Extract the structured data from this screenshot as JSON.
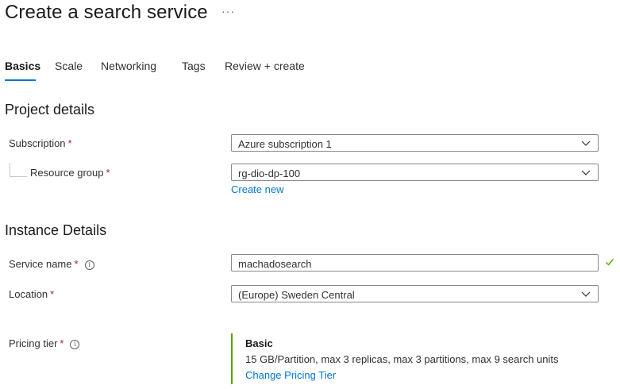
{
  "page": {
    "title": "Create a search service",
    "more_label": "···"
  },
  "tabs": [
    {
      "label": "Basics",
      "active": true
    },
    {
      "label": "Scale"
    },
    {
      "label": "Networking"
    },
    {
      "label": "Tags"
    },
    {
      "label": "Review + create"
    }
  ],
  "project_details": {
    "heading": "Project details",
    "subscription": {
      "label": "Subscription",
      "required": "*",
      "value": "Azure subscription 1"
    },
    "resource_group": {
      "label": "Resource group",
      "required": "*",
      "value": "rg-dio-dp-100",
      "create_new": "Create new"
    }
  },
  "instance_details": {
    "heading": "Instance Details",
    "service_name": {
      "label": "Service name",
      "required": "*",
      "value": "machadosearch",
      "valid": true
    },
    "location": {
      "label": "Location",
      "required": "*",
      "value": "(Europe) Sweden Central"
    },
    "pricing_tier": {
      "label": "Pricing tier",
      "required": "*",
      "tier": "Basic",
      "description": "15 GB/Partition, max 3 replicas, max 3 partitions, max 9 search units",
      "change_link": "Change Pricing Tier"
    }
  },
  "colors": {
    "accent": "#0078d4",
    "required": "#a4262c",
    "valid": "#57a300",
    "tier_bar": "#57a300"
  }
}
